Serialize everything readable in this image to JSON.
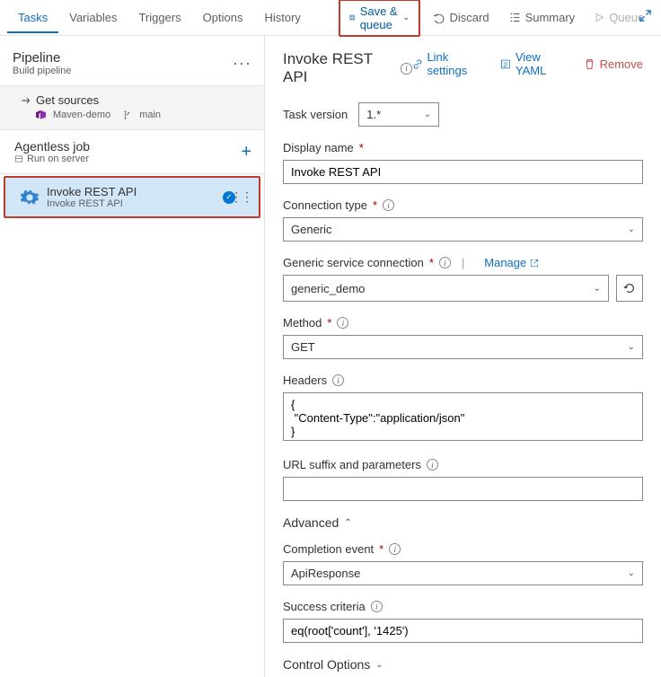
{
  "topTabs": {
    "tasks": "Tasks",
    "variables": "Variables",
    "triggers": "Triggers",
    "options": "Options",
    "history": "History"
  },
  "toolbar": {
    "saveQueue": "Save & queue",
    "discard": "Discard",
    "summary": "Summary",
    "queue": "Queue",
    "more": "···"
  },
  "sidebar": {
    "pipeline": {
      "title": "Pipeline",
      "sub": "Build pipeline"
    },
    "sources": {
      "title": "Get sources",
      "repo": "Maven-demo",
      "branch": "main"
    },
    "job": {
      "title": "Agentless job",
      "sub": "Run on server"
    },
    "task": {
      "name": "Invoke REST API",
      "sub": "Invoke REST API"
    }
  },
  "content": {
    "title": "Invoke REST API",
    "actions": {
      "linkSettings": "Link settings",
      "viewYaml": "View YAML",
      "remove": "Remove"
    },
    "taskVersion": {
      "label": "Task version",
      "value": "1.*"
    },
    "displayName": {
      "label": "Display name",
      "value": "Invoke REST API"
    },
    "connectionType": {
      "label": "Connection type",
      "value": "Generic"
    },
    "serviceConn": {
      "label": "Generic service connection",
      "value": "generic_demo",
      "manage": "Manage"
    },
    "method": {
      "label": "Method",
      "value": "GET"
    },
    "headers": {
      "label": "Headers",
      "value": "{\n \"Content-Type\":\"application/json\"\n}"
    },
    "urlSuffix": {
      "label": "URL suffix and parameters",
      "value": ""
    },
    "advanced": "Advanced",
    "completionEvent": {
      "label": "Completion event",
      "value": "ApiResponse"
    },
    "successCriteria": {
      "label": "Success criteria",
      "value": "eq(root['count'], '1425')"
    },
    "controlOptions": "Control Options"
  }
}
